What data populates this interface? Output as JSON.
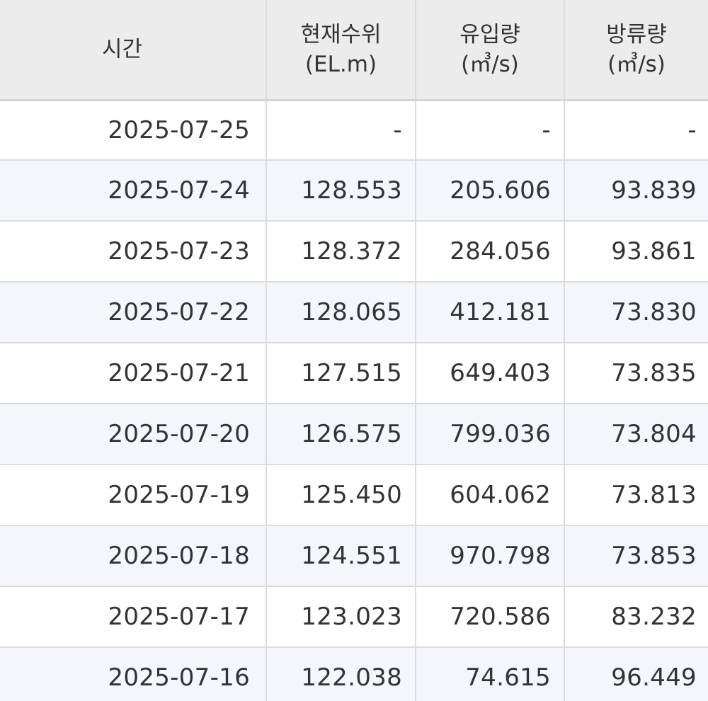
{
  "headers": {
    "time": "시간",
    "level_line1": "현재수위",
    "level_line2": "(EL.m)",
    "inflow_line1": "유입량",
    "inflow_line2": "(㎥/s)",
    "outflow_line1": "방류량",
    "outflow_line2": "(㎥/s)"
  },
  "rows": [
    {
      "date": "2025-07-25",
      "level": "-",
      "inflow": "-",
      "outflow": "-"
    },
    {
      "date": "2025-07-24",
      "level": "128.553",
      "inflow": "205.606",
      "outflow": "93.839"
    },
    {
      "date": "2025-07-23",
      "level": "128.372",
      "inflow": "284.056",
      "outflow": "93.861"
    },
    {
      "date": "2025-07-22",
      "level": "128.065",
      "inflow": "412.181",
      "outflow": "73.830"
    },
    {
      "date": "2025-07-21",
      "level": "127.515",
      "inflow": "649.403",
      "outflow": "73.835"
    },
    {
      "date": "2025-07-20",
      "level": "126.575",
      "inflow": "799.036",
      "outflow": "73.804"
    },
    {
      "date": "2025-07-19",
      "level": "125.450",
      "inflow": "604.062",
      "outflow": "73.813"
    },
    {
      "date": "2025-07-18",
      "level": "124.551",
      "inflow": "970.798",
      "outflow": "73.853"
    },
    {
      "date": "2025-07-17",
      "level": "123.023",
      "inflow": "720.586",
      "outflow": "83.232"
    },
    {
      "date": "2025-07-16",
      "level": "122.038",
      "inflow": "74.615",
      "outflow": "96.449"
    }
  ]
}
